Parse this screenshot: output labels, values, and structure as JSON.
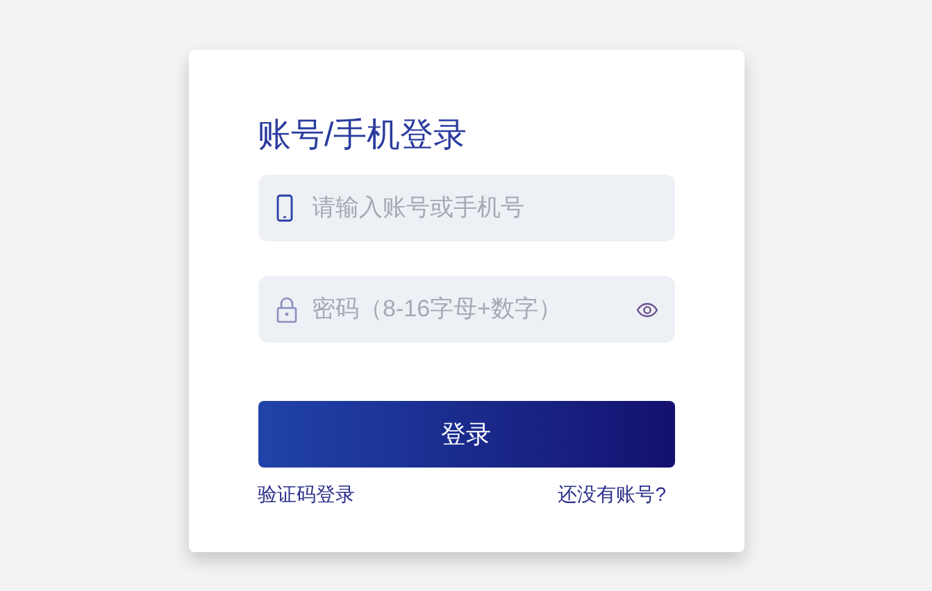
{
  "title": "账号/手机登录",
  "fields": [
    {
      "kind": "phone",
      "placeholder": "请输入账号或手机号"
    },
    {
      "kind": "password",
      "placeholder": "密码（8-16字母+数字）"
    }
  ],
  "submit": "登录",
  "links": [
    "验证码登录",
    "还没有账号?"
  ]
}
